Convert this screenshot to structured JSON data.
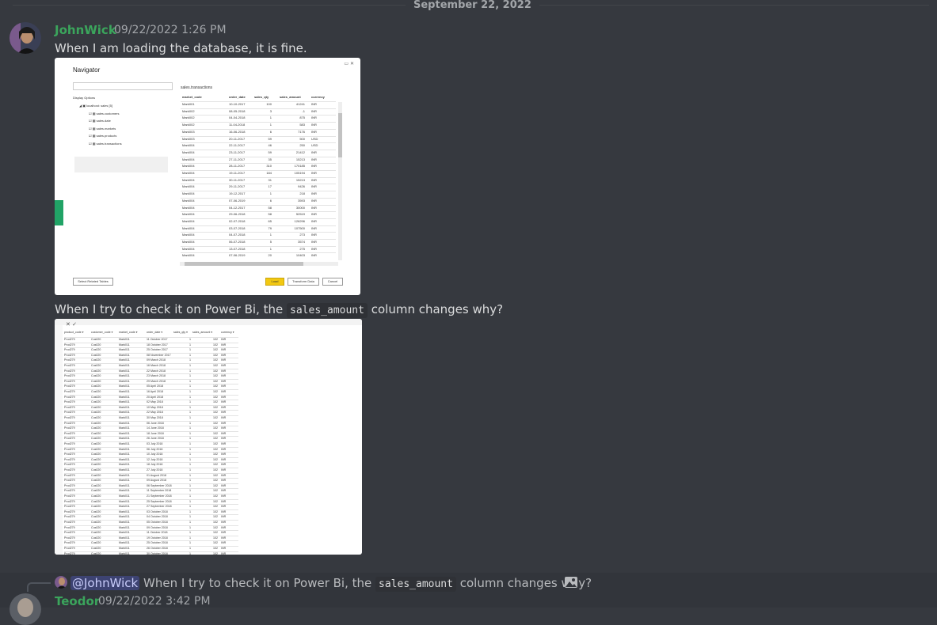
{
  "divider": {
    "date": "September 22, 2022"
  },
  "message1": {
    "author": "JohnWick",
    "timestamp": "09/22/2022 1:26 PM",
    "text1": "When I am loading the database, it is fine.",
    "text2_before": "When I try to check it on Power Bi, the",
    "text2_code": "sales_amount",
    "text2_after": "column changes why?"
  },
  "navigator": {
    "title": "Navigator",
    "display_options": "Display Options",
    "tree": [
      "localhost: sales [5]",
      "sales.customers",
      "sales.date",
      "sales.markets",
      "sales.products",
      "sales.transactions"
    ],
    "table_title": "sales.transactions",
    "columns": [
      "market_code",
      "order_date",
      "sales_qty",
      "sales_amount",
      "currency"
    ],
    "rows": [
      [
        "Mark001",
        "10-10-2017",
        "100",
        "41241",
        "INR"
      ],
      [
        "Mark002",
        "08-05-2018",
        "3",
        "-1",
        "INR"
      ],
      [
        "Mark002",
        "04-04-2018",
        "1",
        "875",
        "INR"
      ],
      [
        "Mark002",
        "11-04-2018",
        "1",
        "583",
        "INR"
      ],
      [
        "Mark003",
        "16-06-2018",
        "6",
        "7176",
        "INR"
      ],
      [
        "Mark003",
        "20-11-2017",
        "59",
        "500",
        "USD"
      ],
      [
        "Mark004",
        "22-11-2017",
        "46",
        "250",
        "USD"
      ],
      [
        "Mark004",
        "23-11-2017",
        "59",
        "21412",
        "INR"
      ],
      [
        "Mark004",
        "27-11-2017",
        "35",
        "15213",
        "INR"
      ],
      [
        "Mark004",
        "28-11-2017",
        "310",
        "170185",
        "INR"
      ],
      [
        "Mark004",
        "19-11-2017",
        "184",
        "105194",
        "INR"
      ],
      [
        "Mark004",
        "30-11-2017",
        "31",
        "15213",
        "INR"
      ],
      [
        "Mark004",
        "29-11-2017",
        "17",
        "9426",
        "INR"
      ],
      [
        "Mark004",
        "19-12-2017",
        "1",
        "218",
        "INR"
      ],
      [
        "Mark004",
        "07-06-2019",
        "6",
        "3593",
        "INR"
      ],
      [
        "Mark004",
        "04-12-2017",
        "58",
        "30000",
        "INR"
      ],
      [
        "Mark004",
        "29-06-2018",
        "58",
        "52519",
        "INR"
      ],
      [
        "Mark004",
        "02-07-2018",
        "65",
        "126296",
        "INR"
      ],
      [
        "Mark004",
        "03-07-2018",
        "79",
        "107500",
        "INR"
      ],
      [
        "Mark004",
        "04-07-2018",
        "1",
        "273",
        "INR"
      ],
      [
        "Mark004",
        "06-07-2018",
        "5",
        "3574",
        "INR"
      ],
      [
        "Mark004",
        "13-07-2018",
        "1",
        "275",
        "INR"
      ],
      [
        "Mark004",
        "07-06-2019",
        "20",
        "10403",
        "INR"
      ]
    ],
    "select_related": "Select Related Tables",
    "load": "Load",
    "transform": "Transform Data",
    "cancel": "Cancel"
  },
  "powerbi": {
    "columns": [
      "product_code",
      "customer_code",
      "market_code",
      "order_date",
      "sales_qty",
      "sales_amount",
      "currency"
    ],
    "product": "Prod279",
    "customer": "Cus020",
    "market": "Mark011",
    "dates": [
      "11 October 2017",
      "18 October 2017",
      "25 October 2017",
      "08 November 2017",
      "09 March 2018",
      "16 March 2018",
      "22 March 2018",
      "23 March 2018",
      "29 March 2018",
      "05 April 2018",
      "16 April 2018",
      "20 April 2018",
      "02 May 2018",
      "10 May 2018",
      "22 May 2018",
      "30 May 2018",
      "06 June 2018",
      "14 June 2018",
      "18 June 2018",
      "26 June 2018",
      "03 July 2018",
      "06 July 2018",
      "10 July 2018",
      "12 July 2018",
      "18 July 2018",
      "27 July 2018",
      "01 August 2018",
      "09 August 2018",
      "06 September 2018",
      "11 September 2018",
      "21 September 2018",
      "25 September 2018",
      "27 September 2018",
      "03 October 2018",
      "04 October 2018",
      "05 October 2018",
      "09 October 2018",
      "11 October 2018",
      "19 October 2018",
      "25 October 2018",
      "26 October 2018",
      "30 October 2018"
    ],
    "qty": "1",
    "amount": "102",
    "currency": "INR"
  },
  "reply": {
    "mention": "@JohnWick",
    "preview_before": "When I try to check it on Power Bi, the",
    "preview_code": "sales_amount",
    "preview_after": "column changes why?"
  },
  "message2": {
    "author": "Teodor",
    "timestamp": "09/22/2022 3:42 PM"
  },
  "colors": {
    "background": "#36393f",
    "username": "#3ba55c",
    "mention": "#c9cdfb"
  }
}
